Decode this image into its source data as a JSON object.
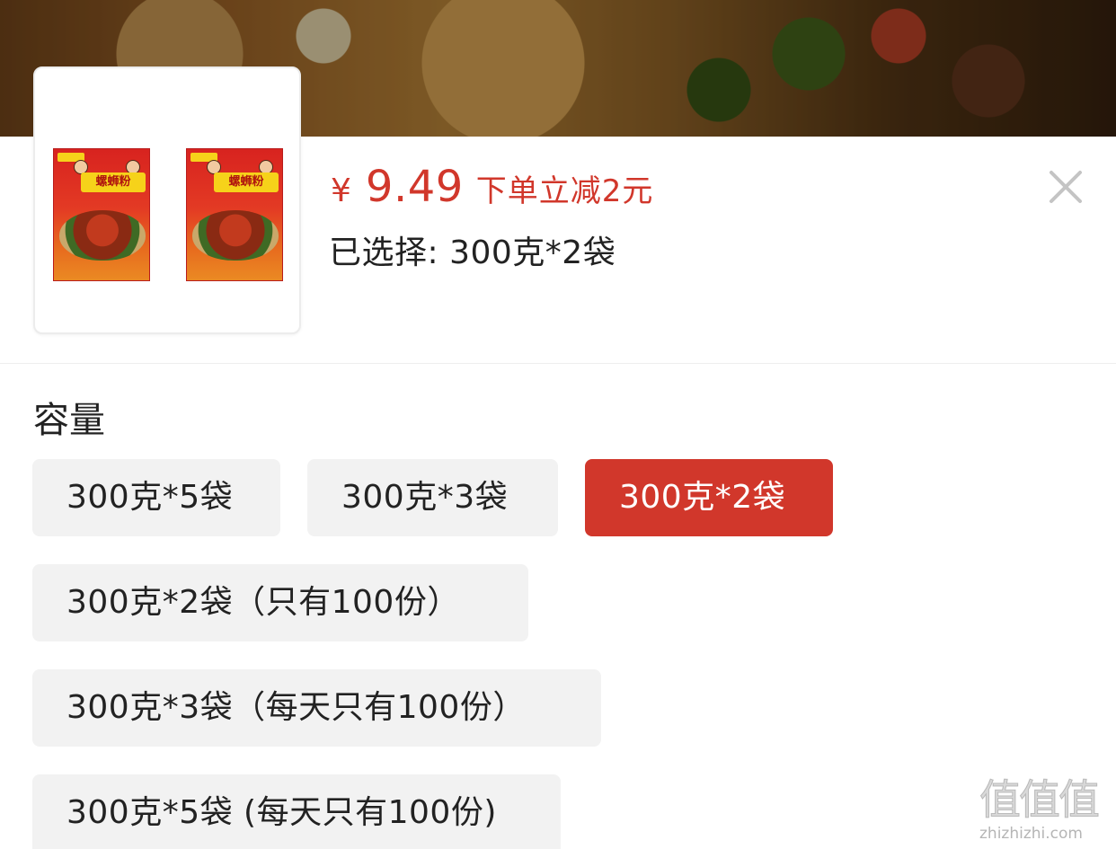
{
  "product": {
    "image_name": "luosifen-product-image",
    "brand_color": "#d8231f"
  },
  "price": {
    "symbol": "¥",
    "value": "9.49",
    "promo": "下单立减2元",
    "color": "#d1372b"
  },
  "selection": {
    "text": "已选择: 300克*2袋"
  },
  "close_icon": "close-icon",
  "section": {
    "title": "容量"
  },
  "options": [
    {
      "label": "300克*5袋",
      "selected": false
    },
    {
      "label": "300克*3袋",
      "selected": false
    },
    {
      "label": "300克*2袋",
      "selected": true
    },
    {
      "label": "300克*2袋（只有100份）",
      "selected": false
    },
    {
      "label": "300克*3袋（每天只有100份）",
      "selected": false
    },
    {
      "label": "300克*5袋 (每天只有100份)",
      "selected": false
    }
  ],
  "watermark": {
    "mark": "值值值",
    "url": "zhizhizhi.com"
  }
}
